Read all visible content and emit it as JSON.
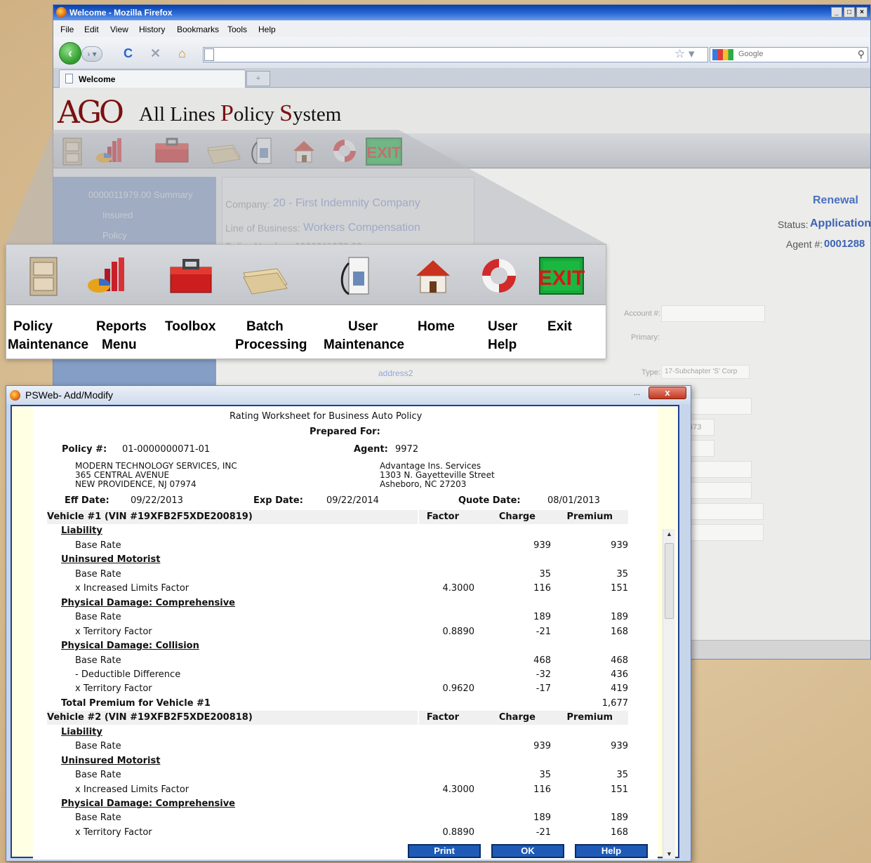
{
  "browser": {
    "title": "Welcome - Mozilla Firefox",
    "menu": [
      "File",
      "Edit",
      "View",
      "History",
      "Bookmarks",
      "Tools",
      "Help"
    ],
    "search_placeholder": "Google",
    "tab_label": "Welcome"
  },
  "app": {
    "logo_mark": "AGO",
    "logo_title_parts": [
      "All Lines ",
      "P",
      "olicy ",
      "S",
      "ystem"
    ]
  },
  "toolbar": {
    "exit_glyph": "EXIT"
  },
  "background_page": {
    "tree_root": "0000011979.00 Summary",
    "tree_items": [
      "Insured",
      "Policy"
    ],
    "company_label": "Company:",
    "company_value": "20 - First Indemnity Company",
    "lob_label": "Line of Business:",
    "lob_value": "Workers Compensation",
    "policy_number": "Policy Number: 0000011979.00",
    "renewal": "Renewal",
    "status_label": "Status:",
    "status_value": "Application",
    "agent_label": "Agent #:",
    "agent_value": "0001288",
    "account_label": "Account #:",
    "primary_label": "Primary:",
    "address2": "address2",
    "type_label": "Type:",
    "type_value": "17-Subchapter 'S' Corp",
    "field_fragment": "473"
  },
  "callout": {
    "items": [
      {
        "l1": "Policy",
        "l2": "Maintenance"
      },
      {
        "l1": "Reports",
        "l2": "Menu"
      },
      {
        "l1": "Toolbox",
        "l2": ""
      },
      {
        "l1": "Batch",
        "l2": "Processing"
      },
      {
        "l1": "User",
        "l2": "Maintenance"
      },
      {
        "l1": "Home",
        "l2": ""
      },
      {
        "l1": "User",
        "l2": "Help"
      },
      {
        "l1": "Exit",
        "l2": ""
      }
    ]
  },
  "dialog": {
    "title": "PSWeb- Add/Modify",
    "close": "x",
    "heading": "Rating Worksheet for Business Auto Policy",
    "prepared_for": "Prepared For:",
    "policy_label": "Policy #:",
    "policy_value": "01-0000000071-01",
    "agent_label": "Agent:",
    "agent_value": "9972",
    "insured": [
      "MODERN TECHNOLOGY SERVICES, INC",
      "365 CENTRAL AVENUE",
      "NEW PROVIDENCE, NJ 07974"
    ],
    "agency": [
      "Advantage Ins. Services",
      "1303 N. Gayetteville Street",
      "Asheboro, NC 27203"
    ],
    "eff_label": "Eff Date:",
    "eff_value": "09/22/2013",
    "exp_label": "Exp Date:",
    "exp_value": "09/22/2014",
    "quote_label": "Quote Date:",
    "quote_value": "08/01/2013",
    "col_factor": "Factor",
    "col_charge": "Charge",
    "col_premium": "Premium",
    "rows": [
      {
        "kind": "vhead",
        "label": "Vehicle #1 (VIN #19XFB2F5XDE200819)"
      },
      {
        "kind": "section",
        "label": "Liability"
      },
      {
        "kind": "item",
        "label": "Base Rate",
        "factor": "",
        "charge": "939",
        "premium": "939"
      },
      {
        "kind": "section",
        "label": "Uninsured Motorist"
      },
      {
        "kind": "item",
        "label": "Base Rate",
        "factor": "",
        "charge": "35",
        "premium": "35"
      },
      {
        "kind": "item",
        "label": "x Increased Limits Factor",
        "factor": "4.3000",
        "charge": "116",
        "premium": "151"
      },
      {
        "kind": "section",
        "label": "Physical Damage: Comprehensive"
      },
      {
        "kind": "item",
        "label": "Base Rate",
        "factor": "",
        "charge": "189",
        "premium": "189"
      },
      {
        "kind": "item",
        "label": "x Territory Factor",
        "factor": "0.8890",
        "charge": "-21",
        "premium": "168"
      },
      {
        "kind": "section",
        "label": "Physical Damage: Collision"
      },
      {
        "kind": "item",
        "label": "Base Rate",
        "factor": "",
        "charge": "468",
        "premium": "468"
      },
      {
        "kind": "item",
        "label": "- Deductible Difference",
        "factor": "",
        "charge": "-32",
        "premium": "436"
      },
      {
        "kind": "item",
        "label": "x Territory Factor",
        "factor": "0.9620",
        "charge": "-17",
        "premium": "419"
      },
      {
        "kind": "total",
        "label": "Total Premium for Vehicle #1",
        "factor": "",
        "charge": "",
        "premium": "1,677"
      },
      {
        "kind": "vhead",
        "label": "Vehicle #2 (VIN #19XFB2F5XDE200818)"
      },
      {
        "kind": "section",
        "label": "Liability"
      },
      {
        "kind": "item",
        "label": "Base Rate",
        "factor": "",
        "charge": "939",
        "premium": "939"
      },
      {
        "kind": "section",
        "label": "Uninsured Motorist"
      },
      {
        "kind": "item",
        "label": "Base Rate",
        "factor": "",
        "charge": "35",
        "premium": "35"
      },
      {
        "kind": "item",
        "label": "x Increased Limits Factor",
        "factor": "4.3000",
        "charge": "116",
        "premium": "151"
      },
      {
        "kind": "section",
        "label": "Physical Damage: Comprehensive"
      },
      {
        "kind": "item",
        "label": "Base Rate",
        "factor": "",
        "charge": "189",
        "premium": "189"
      },
      {
        "kind": "item",
        "label": "x Territory Factor",
        "factor": "0.8890",
        "charge": "-21",
        "premium": "168"
      }
    ],
    "buttons": {
      "print": "Print",
      "ok": "OK",
      "help": "Help"
    }
  }
}
